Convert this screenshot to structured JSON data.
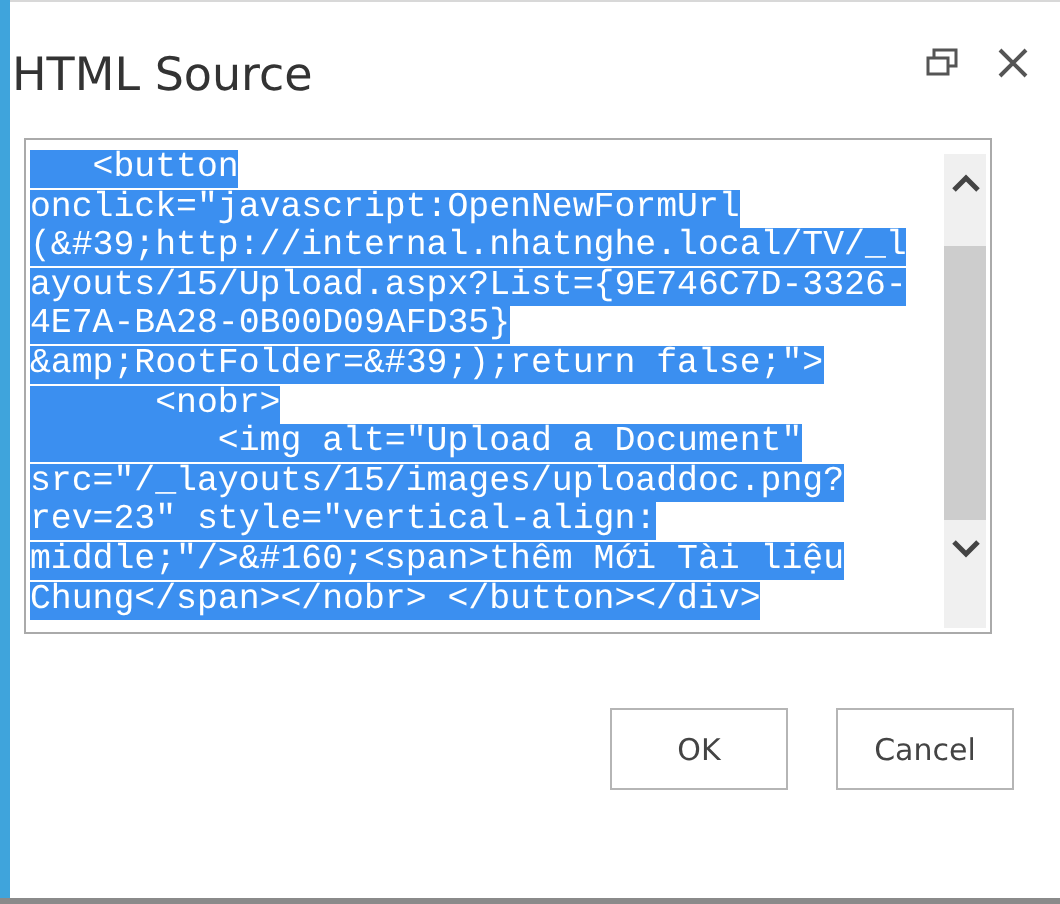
{
  "dialog": {
    "title": "HTML Source",
    "source_lines": [
      "   <button",
      "onclick=\"javascript:OpenNewFormUrl",
      "(&#39;http://internal.nhatnghe.local/TV/_l",
      "ayouts/15/Upload.aspx?List={9E746C7D-3326-",
      "4E7A-BA28-0B00D09AFD35}",
      "&amp;RootFolder=&#39;);return false;\">",
      "      <nobr>",
      "         <img alt=\"Upload a Document\"",
      "src=\"/_layouts/15/images/uploaddoc.png?",
      "rev=23\" style=\"vertical-align:",
      "middle;\"/>&#160;<span>thêm Mới Tài liệu",
      "Chung</span></nobr> </button></div>"
    ],
    "selected": true,
    "buttons": [
      {
        "label": "OK"
      },
      {
        "label": "Cancel"
      }
    ]
  }
}
